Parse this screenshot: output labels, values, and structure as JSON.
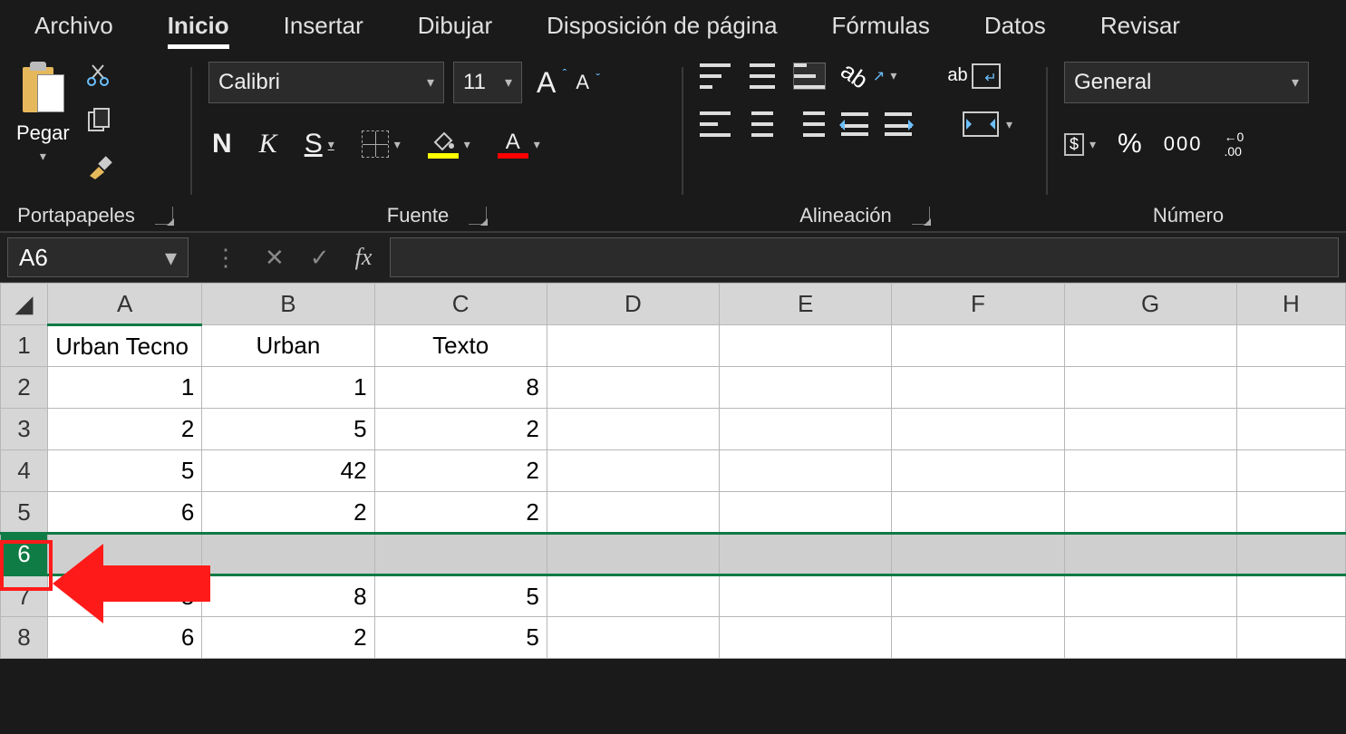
{
  "tabs": {
    "archivo": "Archivo",
    "inicio": "Inicio",
    "insertar": "Insertar",
    "dibujar": "Dibujar",
    "disposicion": "Disposición de página",
    "formulas": "Fórmulas",
    "datos": "Datos",
    "revisar": "Revisar"
  },
  "ribbon": {
    "clipboard": {
      "paste": "Pegar",
      "group": "Portapapeles"
    },
    "font": {
      "name": "Calibri",
      "size": "11",
      "bold": "N",
      "italic": "K",
      "underline": "S",
      "bigA": "A",
      "smallA": "A",
      "colorA": "A",
      "group": "Fuente"
    },
    "alignment": {
      "wrap_ab": "ab",
      "orient": "ab",
      "group": "Alineación"
    },
    "number": {
      "format": "General",
      "pct": "%",
      "thou": "000",
      "dec_inc_top": "←0",
      "dec_inc_bot": ".00",
      "group": "Número"
    }
  },
  "namebox": "A6",
  "fx_label": "fx",
  "columns": [
    "A",
    "B",
    "C",
    "D",
    "E",
    "F",
    "G",
    "H"
  ],
  "rows": [
    {
      "n": "1",
      "a": "Urban Tecno",
      "b": "Urban",
      "c": "Texto",
      "type": "hdr"
    },
    {
      "n": "2",
      "a": "1",
      "b": "1",
      "c": "8"
    },
    {
      "n": "3",
      "a": "2",
      "b": "5",
      "c": "2"
    },
    {
      "n": "4",
      "a": "5",
      "b": "42",
      "c": "2"
    },
    {
      "n": "5",
      "a": "6",
      "b": "2",
      "c": "2"
    },
    {
      "n": "6",
      "a": "",
      "b": "",
      "c": "",
      "selected": true
    },
    {
      "n": "7",
      "a": "5",
      "b": "8",
      "c": "5"
    },
    {
      "n": "8",
      "a": "6",
      "b": "2",
      "c": "5"
    }
  ]
}
